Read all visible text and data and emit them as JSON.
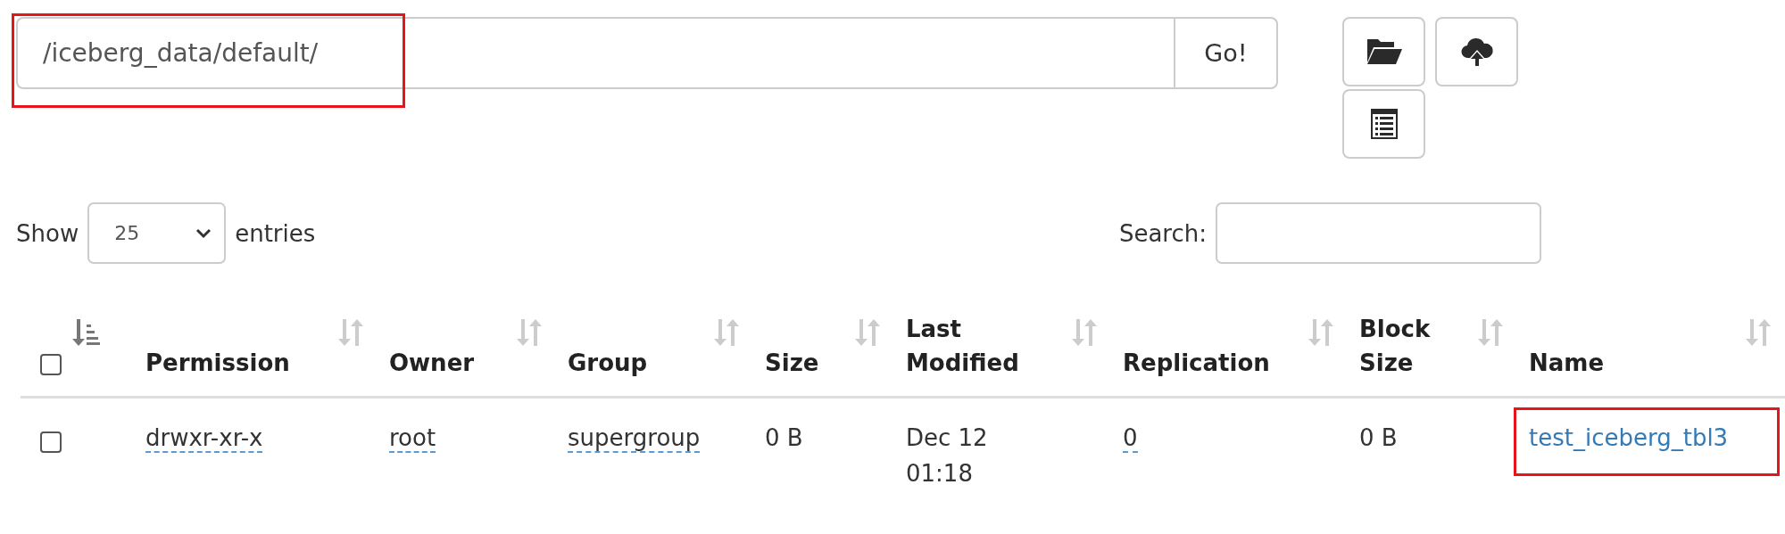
{
  "path_field": {
    "value": "/iceberg_data/default/",
    "highlighted": true
  },
  "go_button": {
    "label": "Go!"
  },
  "tool_buttons": [
    {
      "kind": "folder"
    },
    {
      "kind": "upload"
    },
    {
      "kind": "list"
    }
  ],
  "length_menu": {
    "label_before": "Show",
    "value": "25",
    "label_after": "entries"
  },
  "search": {
    "label": "Search:"
  },
  "table": {
    "select_all": {
      "checked": false,
      "sorted_ascending": true
    },
    "columns": [
      {
        "label": "Permission",
        "sorted_ascending": false
      },
      {
        "label": "Owner",
        "sorted_ascending": false
      },
      {
        "label": "Group",
        "sorted_ascending": false
      },
      {
        "label": "Size",
        "sorted_ascending": false
      },
      {
        "label": "Last Modified",
        "sorted_ascending": false
      },
      {
        "label": "Replication",
        "sorted_ascending": false
      },
      {
        "label": "Block Size",
        "sorted_ascending": false
      },
      {
        "label": "Name",
        "sorted_ascending": false
      }
    ],
    "rows": [
      {
        "checked": false,
        "cells": [
          {
            "kind": "abbr",
            "text": "drwxr-xr-x"
          },
          {
            "kind": "abbr",
            "text": "root"
          },
          {
            "kind": "abbr",
            "text": "supergroup"
          },
          {
            "kind": "text",
            "text": "0 B"
          },
          {
            "kind": "text",
            "text": "Dec 12 01:18"
          },
          {
            "kind": "abbr",
            "text": "0"
          },
          {
            "kind": "text",
            "text": "0 B"
          },
          {
            "kind": "link",
            "text": "test_iceberg_tbl3",
            "highlighted": true
          }
        ]
      }
    ]
  }
}
